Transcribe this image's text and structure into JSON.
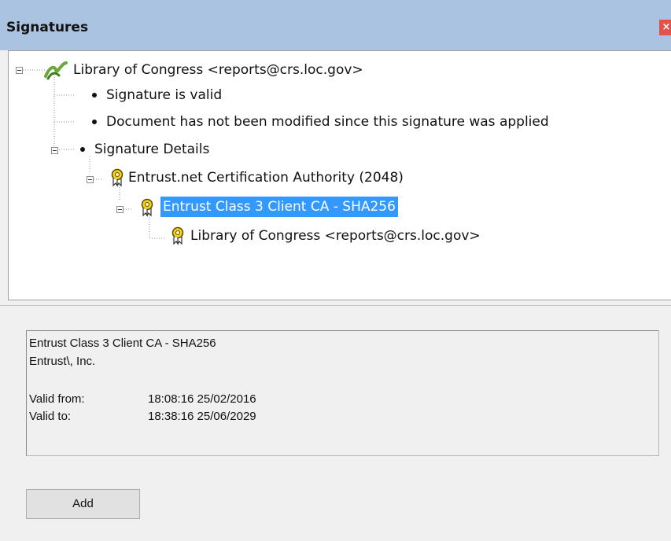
{
  "window": {
    "title": "Signatures",
    "close_glyph": "×"
  },
  "tree": {
    "root": {
      "label": "Library of Congress <reports@crs.loc.gov>",
      "icon": "signature-pen-icon"
    },
    "items": [
      {
        "label": "Signature is valid"
      },
      {
        "label": "Document has not been modified since this signature was applied"
      },
      {
        "label": "Signature Details"
      }
    ],
    "certs": [
      {
        "label": "Entrust.net Certification Authority (2048)",
        "icon": "certificate-icon"
      },
      {
        "label": "Entrust Class 3 Client CA - SHA256",
        "icon": "certificate-icon",
        "selected": true
      },
      {
        "label": "Library of Congress <reports@crs.loc.gov>",
        "icon": "certificate-icon"
      }
    ]
  },
  "details": {
    "subject": "Entrust Class 3 Client CA - SHA256",
    "org": "Entrust\\, Inc.",
    "valid_from_label": "Valid from:",
    "valid_from": "18:08:16 25/02/2016",
    "valid_to_label": "Valid to:",
    "valid_to": "18:38:16 25/06/2029"
  },
  "buttons": {
    "add_label": "Add"
  },
  "colors": {
    "title_bar": "#a9c3e0",
    "selection": "#3399ff",
    "close": "#e1524b",
    "cert_icon": "#f2d21c"
  }
}
